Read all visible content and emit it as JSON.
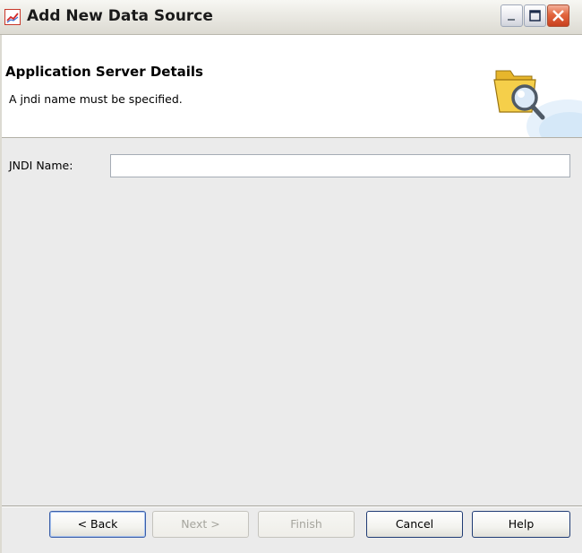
{
  "window": {
    "title": "Add New Data Source",
    "icon": "chart-app-icon",
    "controls": {
      "minimize": "minimize-icon",
      "maximize": "maximize-icon",
      "close": "close-icon"
    }
  },
  "header": {
    "title": "Application Server Details",
    "message": "A jndi name must be specified.",
    "icon": "folder-search-icon"
  },
  "form": {
    "jndi_label": "JNDI Name:",
    "jndi_value": "",
    "jndi_placeholder": ""
  },
  "buttons": {
    "back": "< Back",
    "next": "Next >",
    "finish": "Finish",
    "cancel": "Cancel",
    "help": "Help"
  },
  "colors": {
    "title_bar": "#ecebe5",
    "close_button": "#e2653e",
    "content_background": "#ebebeb",
    "button_border": "#1f3b74"
  }
}
